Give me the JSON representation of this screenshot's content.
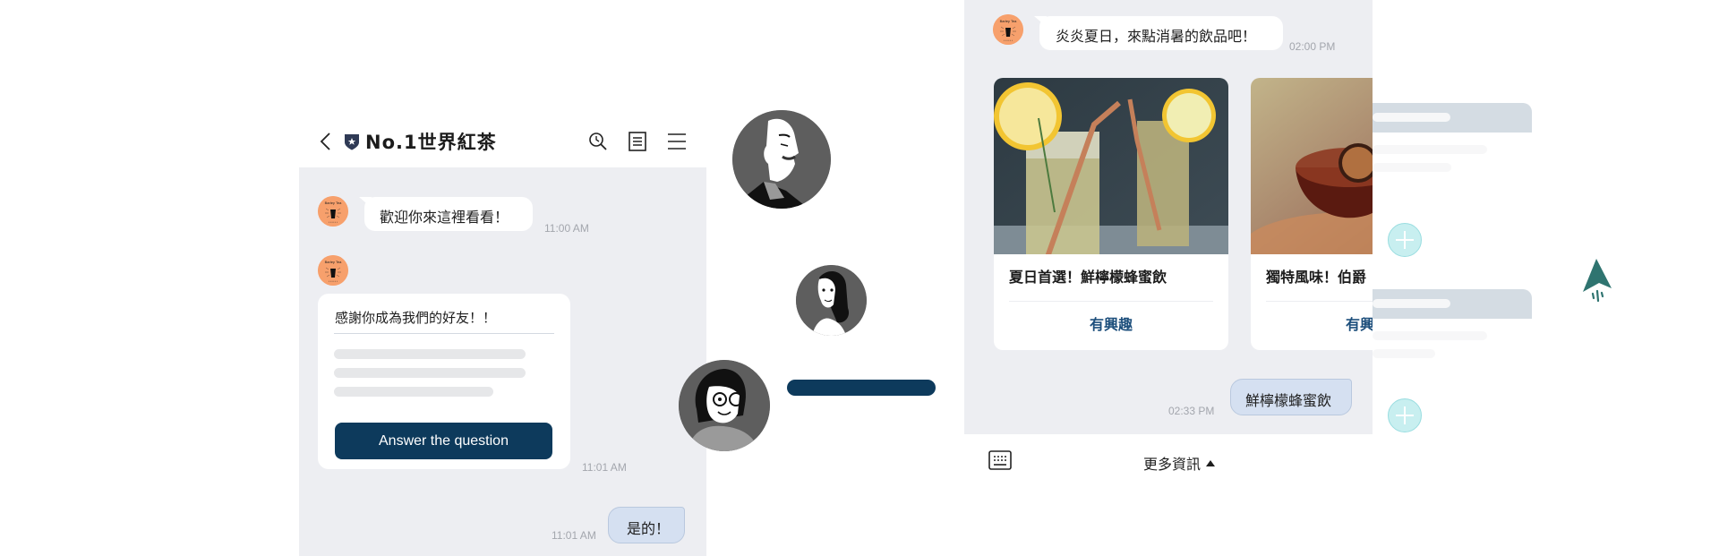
{
  "left_chat": {
    "header": {
      "title": "No.1世界紅茶",
      "icons": [
        "chevron-left-icon",
        "shield-star-icon",
        "search-icon",
        "note-icon",
        "menu-icon"
      ]
    },
    "messages": [
      {
        "sender": "brand",
        "type": "text",
        "text": "歡迎你來這裡看看！",
        "time": "11:00 AM"
      },
      {
        "sender": "brand",
        "type": "card",
        "text": "感謝你成為我們的好友！！",
        "button_label": "Answer the question",
        "time": "11:01 AM"
      },
      {
        "sender": "user",
        "type": "text",
        "text": "是的！",
        "time": "11:01 AM"
      }
    ]
  },
  "right_chat": {
    "messages": [
      {
        "sender": "brand",
        "type": "text",
        "text": "炎炎夏日，來點消暑的飲品吧！",
        "time": "02:00 PM"
      },
      {
        "sender": "user",
        "type": "text",
        "text": "鮮檸檬蜂蜜飲",
        "time": "02:33 PM"
      }
    ],
    "carousel": [
      {
        "title": "夏日首選！鮮檸檬蜂蜜飲",
        "button_label": "有興趣",
        "image": "lemon-honey-drink-photo"
      },
      {
        "title": "獨特風味！伯爵",
        "button_label": "有興",
        "image": "earl-grey-tea-photo"
      }
    ],
    "footer": {
      "keyboard_icon": "keyboard-icon",
      "menu_label": "更多資訊"
    }
  },
  "colors": {
    "brand_navy": "#0d3a5c",
    "chat_bg": "#edeef2",
    "user_bubble": "#d5e0f1",
    "avatar_orange": "#f7a06c",
    "link_blue": "#1d4f7c",
    "accent_teal": "#2f7470",
    "plus_cyan": "#c8eff0"
  }
}
